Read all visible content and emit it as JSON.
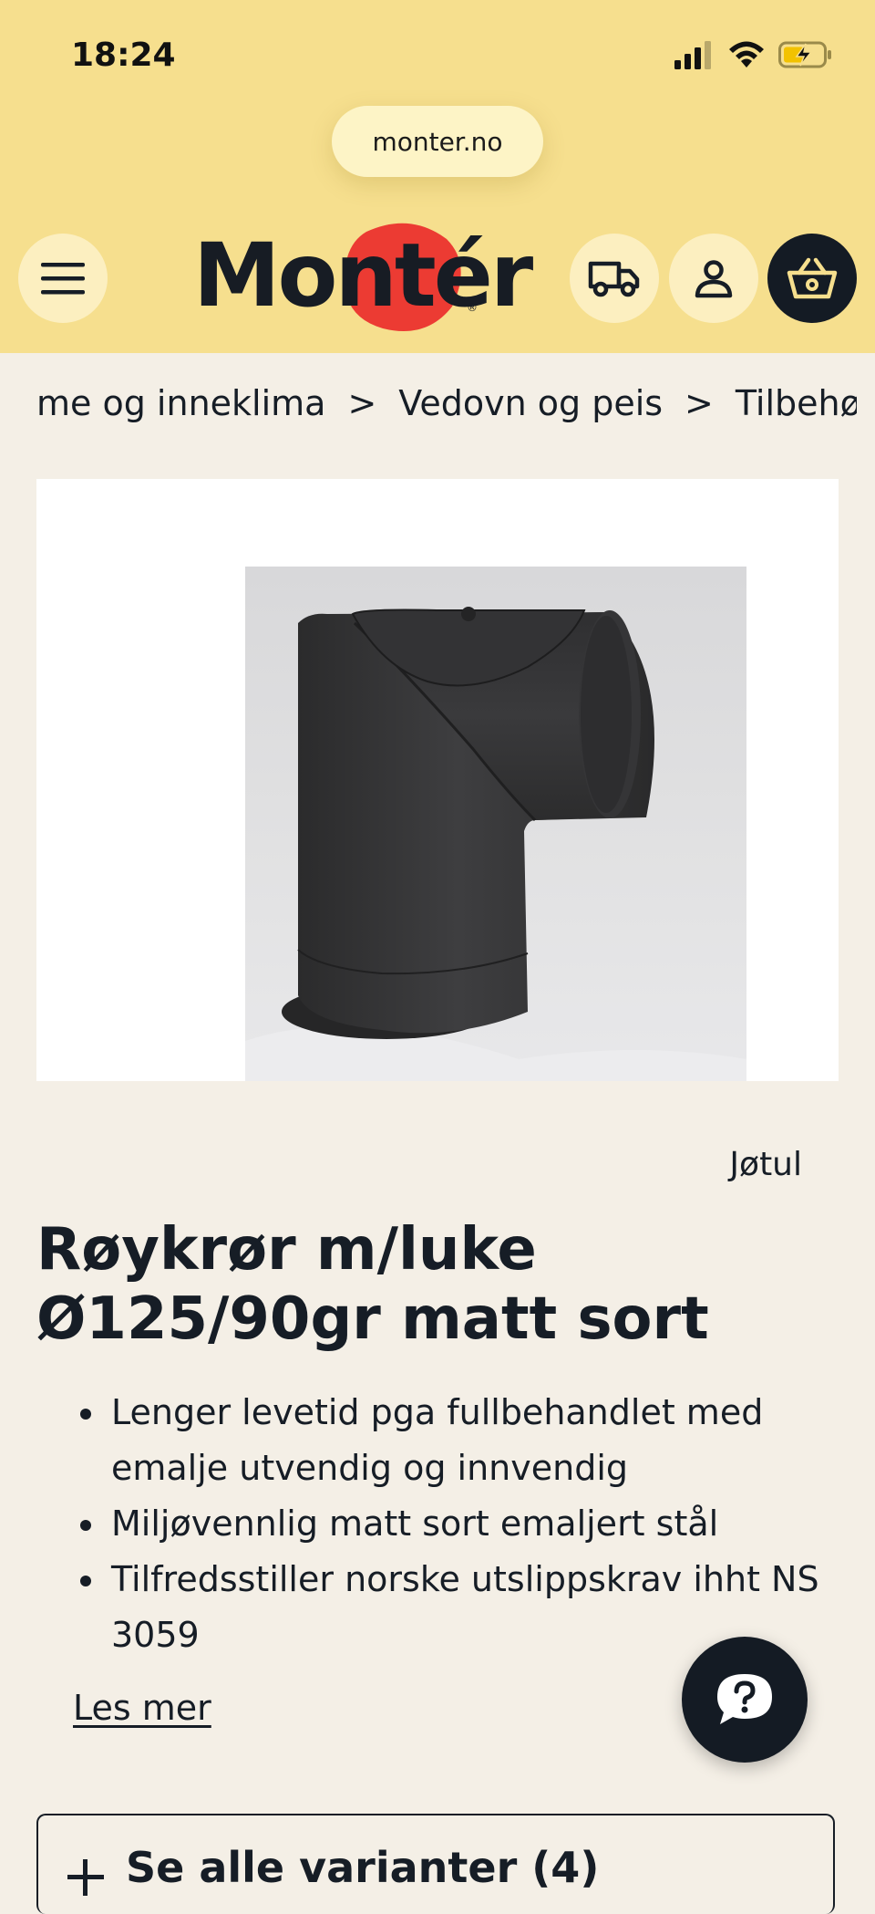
{
  "status_bar": {
    "time": "18:24"
  },
  "browser": {
    "url": "monter.no"
  },
  "header": {
    "logo_text": "Montér"
  },
  "breadcrumb": [
    "me og inneklima",
    ">",
    "Vedovn og peis",
    ">",
    "Tilbehør"
  ],
  "product": {
    "brand": "Jøtul",
    "title": "Røykrør m/luke Ø125/90gr matt sort",
    "features": [
      "Lenger levetid pga fullbehandlet med emalje utvendig og innvendig",
      "Miljøvennlig matt sort emaljert stål",
      "Tilfredsstiller norske utslippskrav ihht NS 3059"
    ],
    "read_more": "Les mer",
    "variants_label": "Se alle varianter (4)"
  },
  "colors": {
    "header_bg": "#f6df8e",
    "page_bg": "#f4efe6",
    "dark": "#141b24",
    "logo_red": "#ec3b33"
  }
}
